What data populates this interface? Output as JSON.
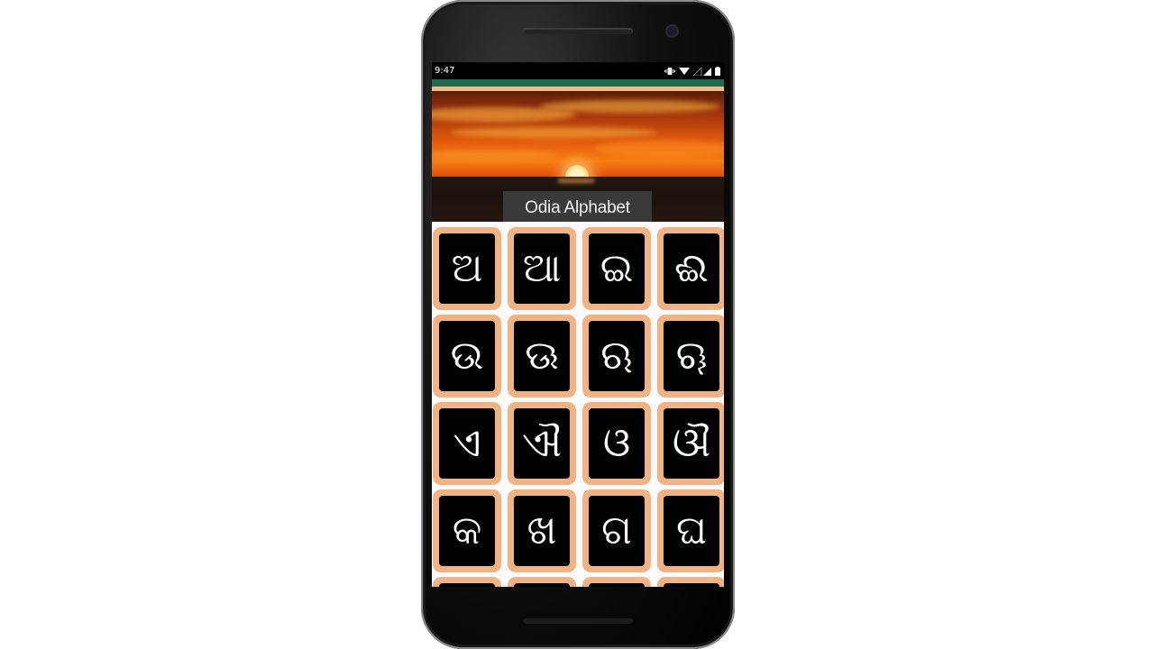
{
  "status_bar": {
    "time": "9:47",
    "icons": [
      "vibrate-icon",
      "wifi-icon",
      "signal-icon",
      "battery-icon"
    ]
  },
  "app": {
    "title": "Odia Alphabet",
    "accent_color": "#1f6b4f",
    "tile_color": "#f1b383"
  },
  "letters": [
    {
      "char": "ଅ"
    },
    {
      "char": "ଆ"
    },
    {
      "char": "ଇ"
    },
    {
      "char": "ଈ"
    },
    {
      "char": "ଉ"
    },
    {
      "char": "ଊ"
    },
    {
      "char": "ଋ"
    },
    {
      "char": "ୠ"
    },
    {
      "char": "ଏ"
    },
    {
      "char": "ଐ"
    },
    {
      "char": "ଓ"
    },
    {
      "char": "ଔ"
    },
    {
      "char": "କ"
    },
    {
      "char": "ଖ"
    },
    {
      "char": "ଗ"
    },
    {
      "char": "ଘ"
    },
    {
      "char": ""
    },
    {
      "char": ""
    },
    {
      "char": ""
    },
    {
      "char": ""
    }
  ]
}
